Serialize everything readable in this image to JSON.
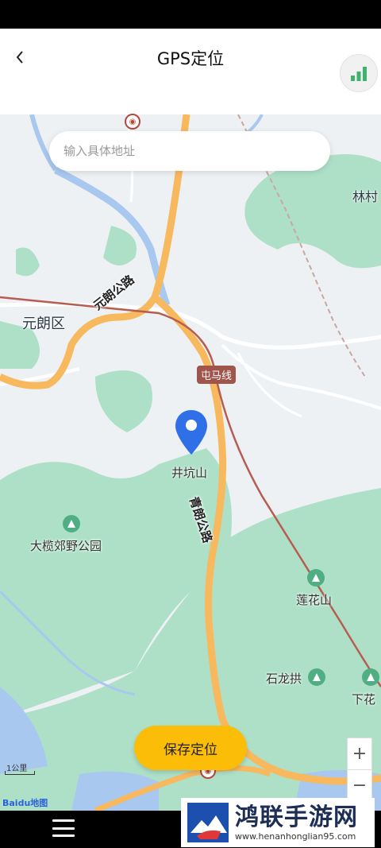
{
  "header": {
    "title": "GPS定位",
    "back_icon": "back-icon",
    "signal_icon": "signal-icon"
  },
  "search": {
    "placeholder": "输入具体地址",
    "value": ""
  },
  "map": {
    "labels": {
      "district": "元朗区",
      "village_top_right": "林村",
      "park": "大榄郊野公园",
      "mountain1": "井坑山",
      "mountain2": "莲花山",
      "mountain3": "石龙拱",
      "place_right": "下花",
      "road1": "元朗公路",
      "road2": "青朗公路",
      "rail": "屯马线"
    },
    "scale": "1公里",
    "logo": "Baidu地图",
    "colors": {
      "water": "#a9c8ef",
      "green": "#aee0c8",
      "highway": "#f7b85e",
      "rail": "#b65d52",
      "land": "#eef1f4"
    }
  },
  "zoom": {
    "in": "+",
    "out": "−"
  },
  "save_button": "保存定位",
  "watermark": {
    "title": "鸿联手游网",
    "url": "www.henanhonglian95.com"
  }
}
